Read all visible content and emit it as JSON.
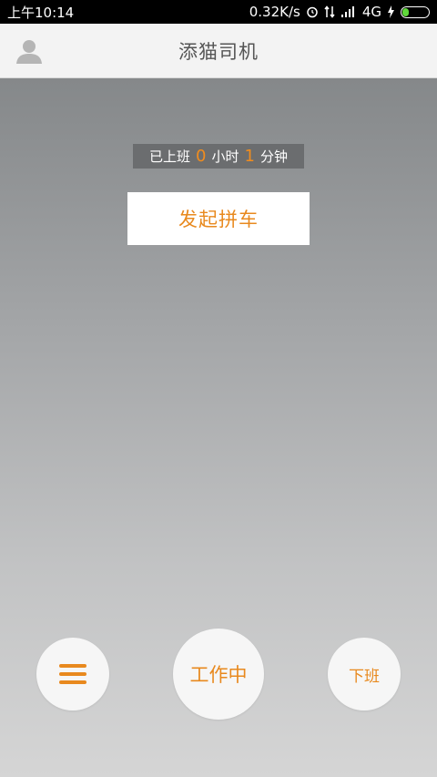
{
  "status_bar": {
    "time": "上午10:14",
    "network_speed": "0.32K/s",
    "network_type": "4G",
    "icons": [
      "alarm-icon",
      "data-transfer-icon",
      "signal-icon",
      "charging-icon",
      "battery-icon"
    ],
    "battery_color": "#5fd83a"
  },
  "header": {
    "title": "添猫司机",
    "avatar_icon": "user-avatar-icon"
  },
  "timer": {
    "prefix": "已上班",
    "hours": "0",
    "hours_unit": "小时",
    "minutes": "1",
    "minutes_unit": "分钟"
  },
  "actions": {
    "carpool_label": "发起拼车",
    "menu_icon": "hamburger-menu-icon",
    "working_label": "工作中",
    "offwork_label": "下班"
  },
  "colors": {
    "accent": "#e8891e",
    "header_bg": "#f3f3f3"
  }
}
